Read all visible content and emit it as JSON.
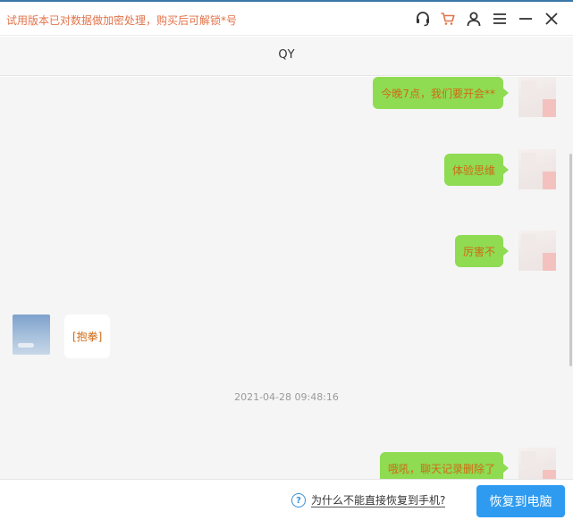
{
  "titlebar": {
    "notice": "试用版本已对数据做加密处理，购买后可解锁*号",
    "icons": [
      "headset-icon",
      "cart-icon",
      "user-icon",
      "menu-icon",
      "minimize-icon",
      "close-icon"
    ]
  },
  "chat": {
    "contact_name": "QY",
    "messages": [
      {
        "side": "me",
        "text": "今晚7点，我们要开会**"
      },
      {
        "side": "me",
        "text": "体验思维"
      },
      {
        "side": "me",
        "text": "厉害不"
      },
      {
        "side": "other",
        "text": "[抱拳]"
      },
      {
        "side": "me",
        "text": "哦吼，聊天记录删除了"
      }
    ],
    "timestamp": "2021-04-28 09:48:16"
  },
  "footer": {
    "help_text": "为什么不能直接恢复到手机?",
    "restore_button": "恢复到电脑"
  },
  "colors": {
    "accent": "#2e9bf0",
    "bubble_me": "#8fdb52",
    "message_text": "#cf6a14",
    "notice_text": "#e2734a"
  }
}
